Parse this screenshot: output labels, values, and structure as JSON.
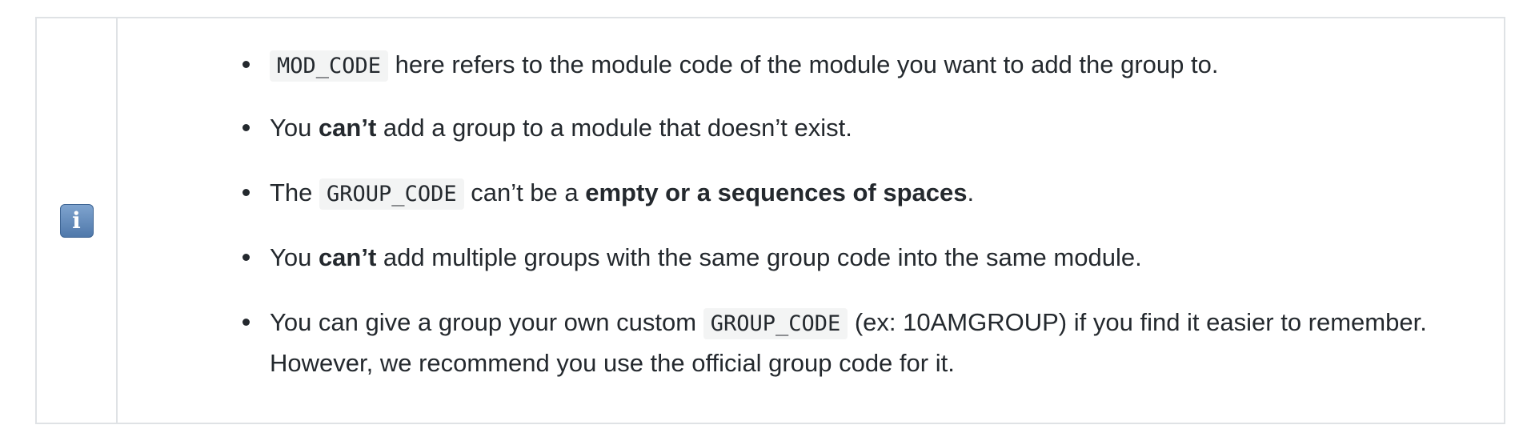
{
  "icon": "information-icon",
  "icon_glyph": "i",
  "notes": [
    {
      "code": "MOD_CODE",
      "text_after": " here refers to the module code of the module you want to add the group to."
    },
    {
      "text_before": "You ",
      "bold": "can’t",
      "text_after": " add a group to a module that doesn’t exist."
    },
    {
      "text_before": "The ",
      "code": "GROUP_CODE",
      "text_middle": " can’t be a ",
      "bold": "empty or a sequences of spaces",
      "text_after": "."
    },
    {
      "text_before": "You ",
      "bold": "can’t",
      "text_after": " add multiple groups with the same group code into the same module."
    },
    {
      "text_before": "You can give a group your own custom ",
      "code": "GROUP_CODE",
      "text_after": " (ex: 10AMGROUP) if you find it easier to remember. However, we recommend you use the official group code for it."
    }
  ]
}
